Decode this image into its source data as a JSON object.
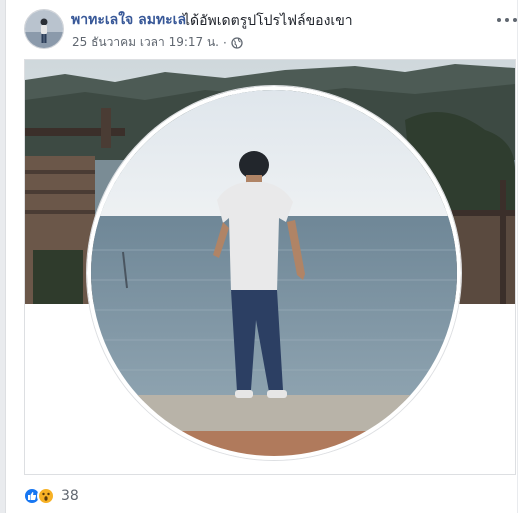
{
  "post": {
    "author_name": "พาทะเลใจ ลมทะเล",
    "action_text": "ได้อัพเดตรูปโปรไฟล์ของเขา",
    "timestamp": "25 ธันวาคม เวลา 19:17 น.",
    "separator": "·",
    "privacy_icon": "globe-icon",
    "more_icon": "ellipsis-icon"
  },
  "reactions": {
    "icons": [
      "like-icon",
      "wow-icon"
    ],
    "count": "38"
  },
  "colors": {
    "author_link": "#385898",
    "like_blue": "#1877f2",
    "wow_yellow": "#f7b125",
    "meta_gray": "#606770"
  }
}
